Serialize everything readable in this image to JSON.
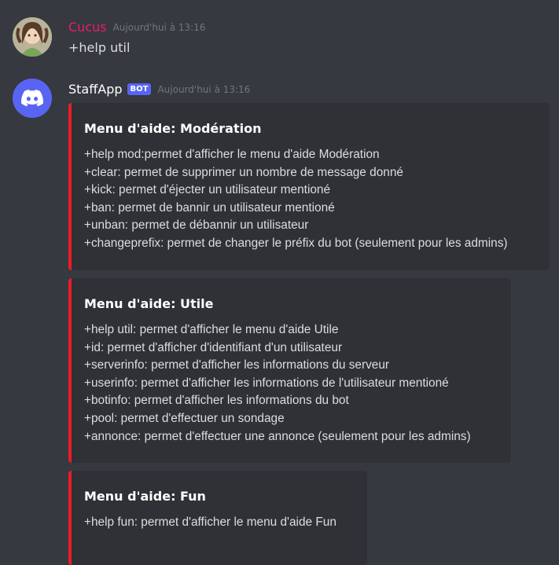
{
  "user_message": {
    "author": "Cucus",
    "timestamp": "Aujourd'hui à 13:16",
    "text": "+help util",
    "author_color": "#e91e63"
  },
  "bot_message": {
    "author": "StaffApp",
    "badge": "BOT",
    "timestamp": "Aujourd'hui à 13:16",
    "avatar_icon": "discord-logo-icon"
  },
  "embeds": [
    {
      "title": "Menu d'aide: Modération",
      "lines": [
        "+help mod:permet d'afficher le menu d'aide Modération",
        "+clear: permet de supprimer un nombre de message donné",
        "+kick: permet d'éjecter un utilisateur mentioné",
        "+ban: permet de bannir un utilisateur mentioné",
        "+unban: permet de débannir un utilisateur",
        "+changeprefix: permet de changer le préfix du bot (seulement pour les admins)"
      ]
    },
    {
      "title": "Menu d'aide: Utile",
      "lines": [
        "+help util: permet d'afficher le menu d'aide Utile",
        "+id: permet d'afficher d'identifiant d'un utilisateur",
        "+serverinfo: permet d'afficher les informations du serveur",
        "+userinfo: permet d'afficher les informations de l'utilisateur mentioné",
        "+botinfo: permet d'afficher les informations du bot",
        "+pool: permet d'effectuer un sondage",
        "+annonce: permet d'effectuer une annonce (seulement pour les admins)"
      ]
    },
    {
      "title": "Menu d'aide: Fun",
      "lines": [
        "+help fun: permet d'afficher le menu d'aide Fun"
      ]
    }
  ],
  "colors": {
    "background": "#36393f",
    "embed_background": "#2f3136",
    "embed_accent": "#ed1c24",
    "badge": "#5865f2"
  }
}
